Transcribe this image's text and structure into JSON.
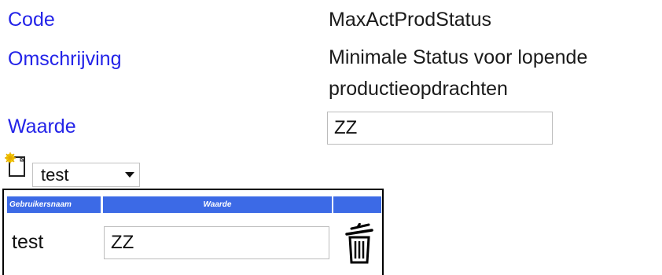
{
  "fields": {
    "code_label": "Code",
    "code_value": "MaxActProdStatus",
    "description_label": "Omschrijving",
    "description_line1": "Minimale Status voor lopende",
    "description_line2": "productieopdrachten",
    "value_label": "Waarde",
    "value_input": "ZZ"
  },
  "toolbar": {
    "user_select_value": "test",
    "icons": [
      "new-document-icon",
      "chevron-down-icon"
    ]
  },
  "grid": {
    "columns": [
      "Gebruikersnaam",
      "Waarde",
      ""
    ],
    "rows": [
      {
        "user": "test",
        "value": "ZZ"
      }
    ],
    "row_action_icon": "trash-icon"
  },
  "colors": {
    "label": "#2323e8",
    "header_bg": "#3c6ae6"
  }
}
